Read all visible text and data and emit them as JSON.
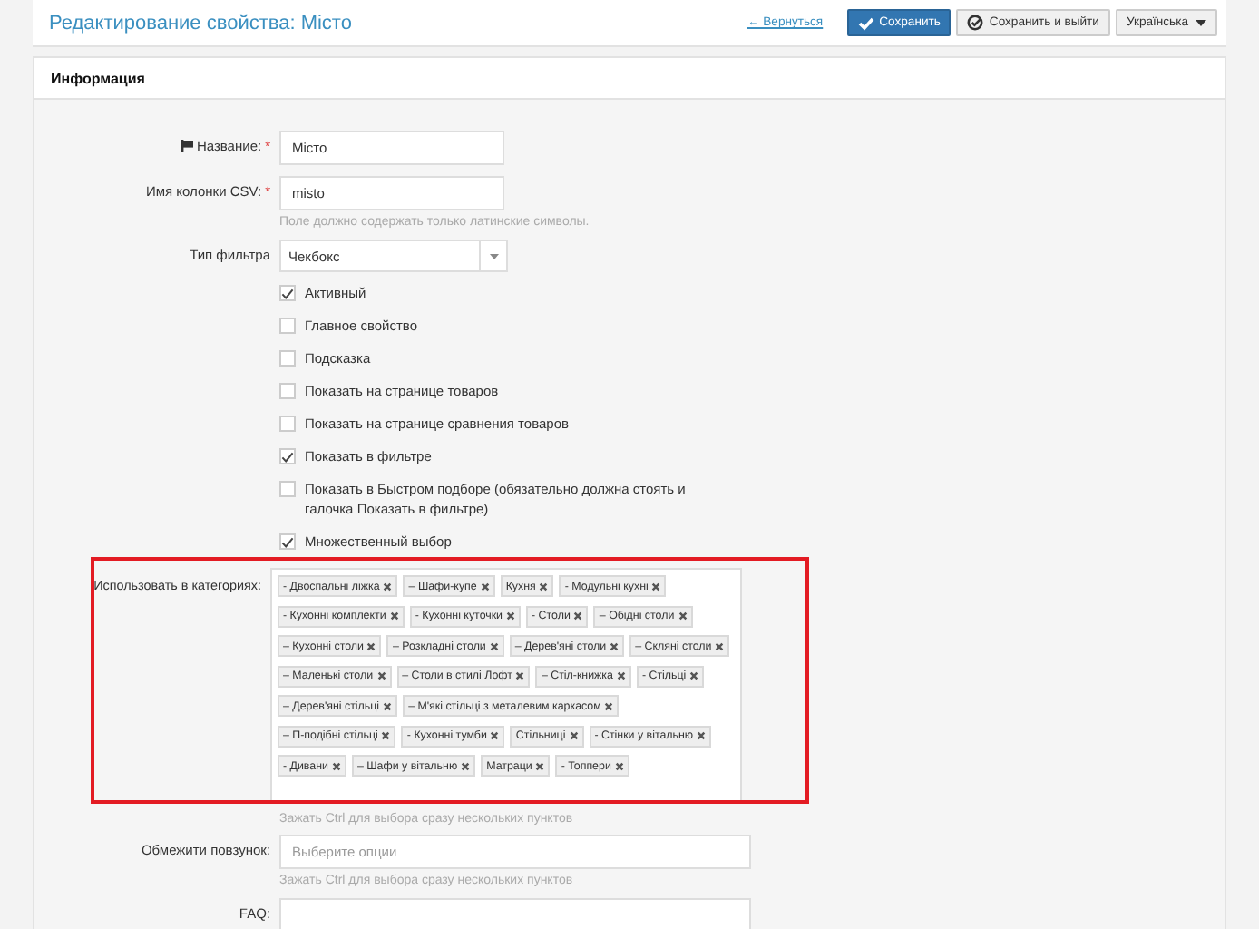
{
  "header": {
    "title": "Редактирование свойства: Місто",
    "back_link": "← Вернуться",
    "buttons": [
      {
        "kind": "primary",
        "label": "Сохранить"
      },
      {
        "kind": "secondary",
        "label": "Сохранить и выйти"
      }
    ],
    "language": "Українська"
  },
  "panel": {
    "title": "Информация"
  },
  "fields": [
    {
      "kind": "text",
      "label": "Название:",
      "flag": true,
      "required_mark": "*",
      "value": "Місто"
    },
    {
      "kind": "text",
      "label": "Имя колонки CSV:",
      "flag": false,
      "required_mark": "*",
      "value": "misto",
      "hint": "Поле должно содержать только латинские символы."
    },
    {
      "kind": "select",
      "label": "Тип фильтра",
      "flag": false,
      "value": "Чекбокс"
    }
  ],
  "checkboxes": [
    {
      "label": "Активный",
      "checked": true
    },
    {
      "label": "Главное свойство",
      "checked": false
    },
    {
      "label": "Подсказка",
      "checked": false
    },
    {
      "label": "Показать на странице товаров",
      "checked": false
    },
    {
      "label": "Показать на странице сравнения товаров",
      "checked": false
    },
    {
      "label": "Показать в фильтре",
      "checked": true
    },
    {
      "label": "Показать в Быстром подборе (обязательно должна стоять и галочка Показать в фильтре)",
      "checked": false
    },
    {
      "label": "Множественный выбор",
      "checked": true
    }
  ],
  "categories": {
    "label": "Использовать в категориях:",
    "highlighted": true,
    "tags": [
      "- Двоспальні ліжка",
      "– Шафи-купе",
      "Кухня",
      "- Модульні кухні",
      "- Кухонні комплекти",
      "- Кухонні куточки",
      "- Столи",
      "– Обідні столи",
      "– Кухонні столи",
      "– Розкладні столи",
      "– Дерев'яні столи",
      "– Скляні столи",
      "– Маленькі столи",
      "– Столи в стилі Лофт",
      "– Стіл-книжка",
      "- Стільці",
      "– Дерев'яні стільці",
      "– М'які стільці з металевим каркасом",
      "– П-подібні стільці",
      "- Кухонні тумби",
      "Стільниці",
      "- Стінки у вітальню",
      "- Дивани",
      "– Шафи у вітальню",
      "Матраци",
      "- Топпери"
    ],
    "hint": "Зажать Ctrl для выбора сразу нескольких пунктов"
  },
  "limit": {
    "label": "Обмежити повзунок:",
    "placeholder": "Выберите опции",
    "hint": "Зажать Ctrl для выбора сразу нескольких пунктов"
  },
  "faq": {
    "label": "FAQ:"
  }
}
